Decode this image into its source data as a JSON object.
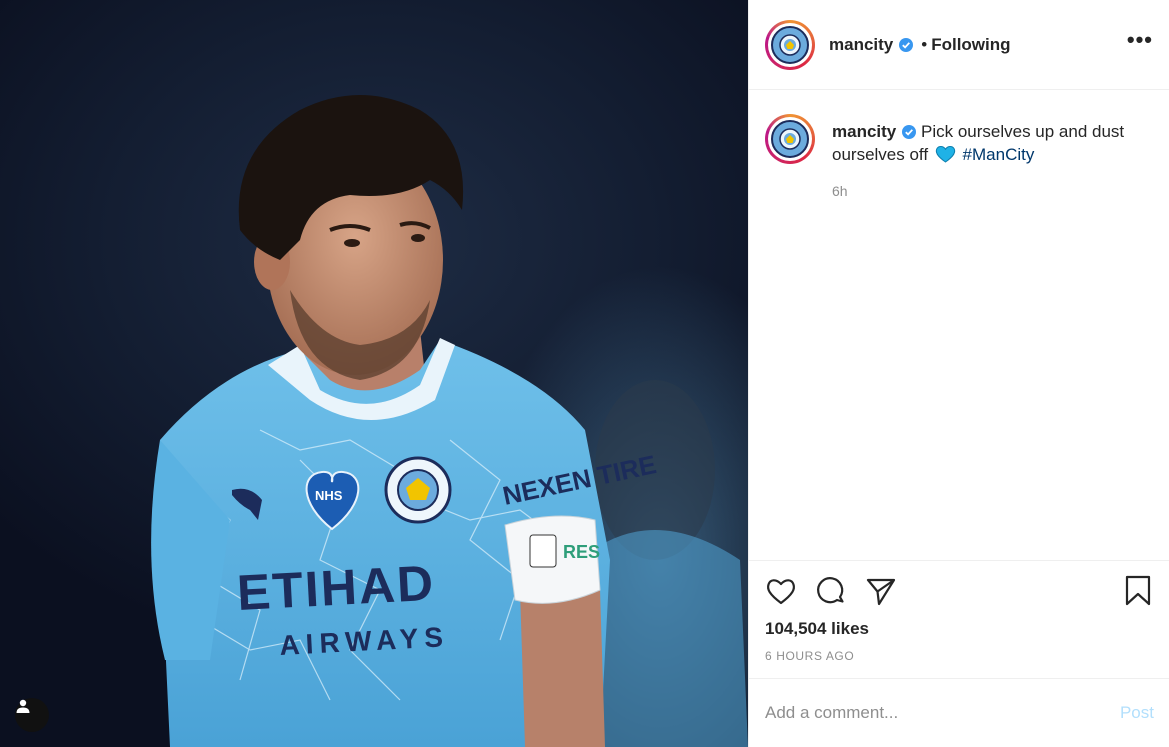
{
  "photo": {
    "description_icons": [
      "user-tag-icon"
    ],
    "jersey": {
      "sponsor_line1": "ETIHAD",
      "sponsor_line2": "AIRWAYS",
      "heart_badge": "NHS",
      "crest_text": "MANCHESTER CITY",
      "sleeve_text": "NEXEN TIRE",
      "armband_text": "RES"
    }
  },
  "header": {
    "username": "mancity",
    "separator": "•",
    "follow_state": "Following",
    "more_label": "•••"
  },
  "caption": {
    "username": "mancity",
    "text": "Pick ourselves up and dust ourselves off",
    "hashtag": "#ManCity",
    "time_ago": "6h"
  },
  "actions": {
    "likes": "104,504 likes",
    "posted_ago": "6 HOURS AGO"
  },
  "comment": {
    "placeholder": "Add a comment...",
    "post_label": "Post"
  },
  "colors": {
    "city_blue": "#6cabdd",
    "navy": "#1c2c5b",
    "verified_blue": "#3897f0",
    "hashtag": "#00376b",
    "post_disabled": "#b2dffc",
    "heart_emoji": "#1fb2e6"
  }
}
